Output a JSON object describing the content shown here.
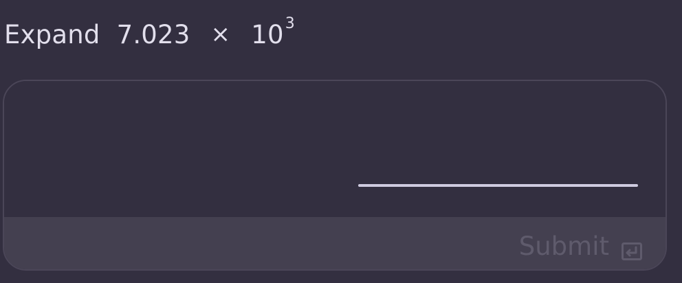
{
  "question": {
    "prompt": "Expand",
    "mantissa": "7.023",
    "times_symbol": "×",
    "base": "10",
    "exponent": "3"
  },
  "answer": {
    "value": ""
  },
  "submit": {
    "label": "Submit",
    "icon": "enter-key-icon"
  },
  "colors": {
    "background": "#332f40",
    "text": "#e2dfec",
    "card_border": "#4b4658",
    "footer": "#444050",
    "answer_line": "#cfcbe0",
    "disabled_text": "#5f5b6c"
  }
}
